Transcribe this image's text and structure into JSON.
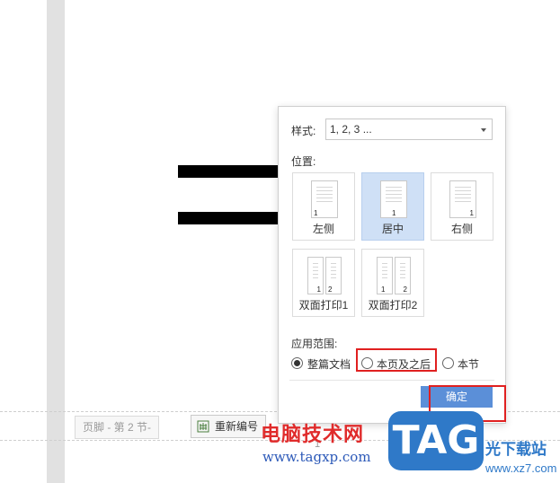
{
  "document": {
    "footer_tag": "页脚 - 第 2 节-",
    "renumber_label": "重新编号",
    "page_number": "1"
  },
  "dialog": {
    "style_label": "样式:",
    "style_value": "1, 2, 3 ...",
    "position_label": "位置:",
    "positions": [
      {
        "label": "左侧",
        "selected": false
      },
      {
        "label": "居中",
        "selected": true
      },
      {
        "label": "右侧",
        "selected": false
      },
      {
        "label": "双面打印1",
        "selected": false
      },
      {
        "label": "双面打印2",
        "selected": false
      }
    ],
    "page_digit_1": "1",
    "page_digit_2": "2",
    "apply_label": "应用范围:",
    "apply_options": [
      {
        "label": "整篇文档",
        "checked": true
      },
      {
        "label": "本页及之后",
        "checked": false
      },
      {
        "label": "本节",
        "checked": false
      }
    ],
    "ok_label": "确定"
  },
  "watermark": {
    "site_cn": "电脑技术网",
    "site_url": "www.tagxp.com",
    "logo_text": "TAG",
    "site2_cn": "光下载站",
    "site2_url": "www.xz7.com"
  },
  "colors": {
    "accent": "#5b8fd8",
    "highlight": "#e02020",
    "selected_tile": "#cfe0f6"
  }
}
